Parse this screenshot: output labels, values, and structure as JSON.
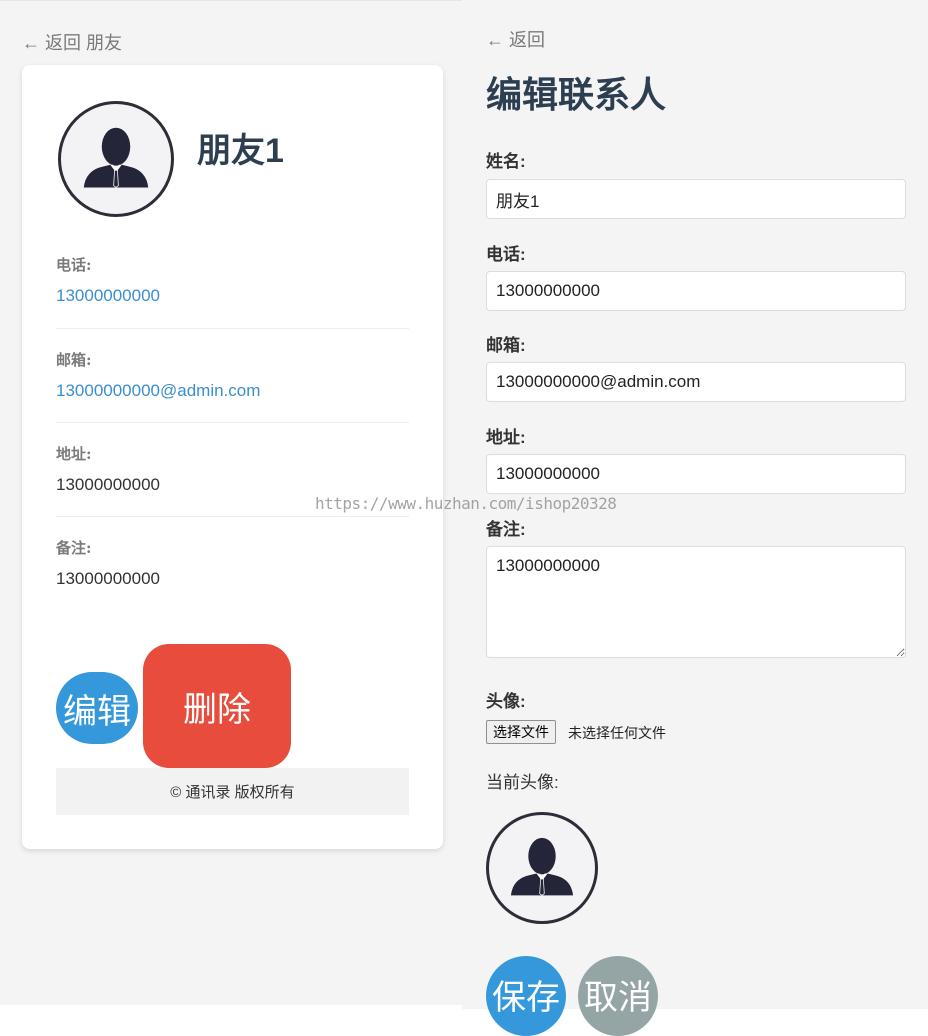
{
  "detail": {
    "back_text": "← 返回 朋友",
    "name": "朋友1",
    "phone_label": "电话:",
    "phone": "13000000000",
    "email_label": "邮箱:",
    "email": "13000000000@admin.com",
    "address_label": "地址:",
    "address": "13000000000",
    "notes_label": "备注:",
    "notes": "13000000000",
    "edit_label": "编辑",
    "delete_label": "删除",
    "footer": "© 通讯录 版权所有"
  },
  "edit_form": {
    "back_text": "← 返回",
    "title": "编辑联系人",
    "name_label": "姓名:",
    "name_value": "朋友1",
    "phone_label": "电话:",
    "phone_value": "13000000000",
    "email_label": "邮箱:",
    "email_value": "13000000000@admin.com",
    "address_label": "地址:",
    "address_value": "13000000000",
    "notes_label": "备注:",
    "notes_value": "13000000000",
    "avatar_label": "头像:",
    "file_button": "选择文件",
    "file_status": "未选择任何文件",
    "current_avatar_label": "当前头像:",
    "save_label": "保存",
    "cancel_label": "取消"
  },
  "watermark": "https://www.huzhan.com/ishop20328",
  "colors": {
    "primary": "#3498db",
    "danger": "#e74c3c",
    "muted": "#95a5a6",
    "link": "#3a8ecf",
    "heading": "#2c3e50"
  },
  "icons": {
    "avatar": "person-silhouette-icon"
  }
}
